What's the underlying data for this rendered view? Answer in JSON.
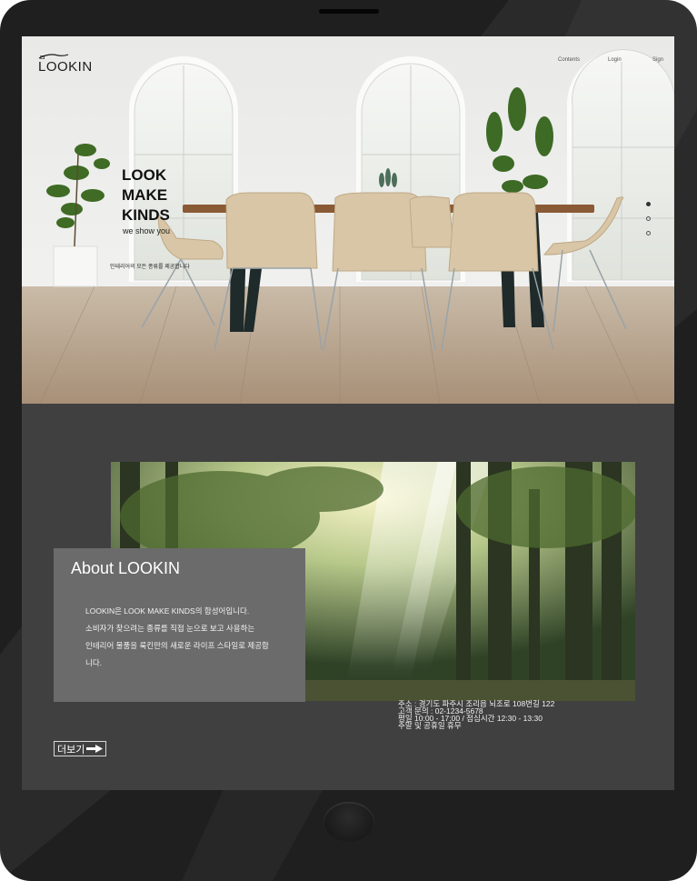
{
  "brand": {
    "logo_mark": "ㅁ",
    "logo_text": "LOOKIN"
  },
  "nav": {
    "items": [
      {
        "label": "Contents"
      },
      {
        "label": "Login"
      },
      {
        "label": "Sign"
      }
    ]
  },
  "hero": {
    "title_lines": [
      "LOOK",
      "MAKE",
      "KINDS"
    ],
    "subtitle": "we show you",
    "description": "인테리어의 모든 종류를 제공합니다",
    "slides": 3,
    "active_slide": 1
  },
  "about": {
    "title": "About LOOKIN",
    "text_lines": [
      "LOOKIN은 LOOK MAKE KINDS의 합성어입니다.",
      "소비자가 찾으려는 종류를 직접 눈으로 보고 사용하는",
      "인테리어 물품을 룩킨만의 새로운 라이프 스타일로 제공합",
      "니다."
    ]
  },
  "info": {
    "lines": [
      "주소 : 경기도 파주시 조리읍 뇌조로 108번길 122",
      "고객 문의 : 02-1234-5678",
      "평일 10:00 - 17:00 / 점심시간 12:30 - 13:30",
      "주말 및 공휴일 휴무"
    ]
  },
  "more_button": {
    "label": "더보기",
    "icon": "arrow-right-icon"
  },
  "colors": {
    "device": "#1f1f1f",
    "page_background": "#404040",
    "about_card": "#6b6b6b"
  }
}
